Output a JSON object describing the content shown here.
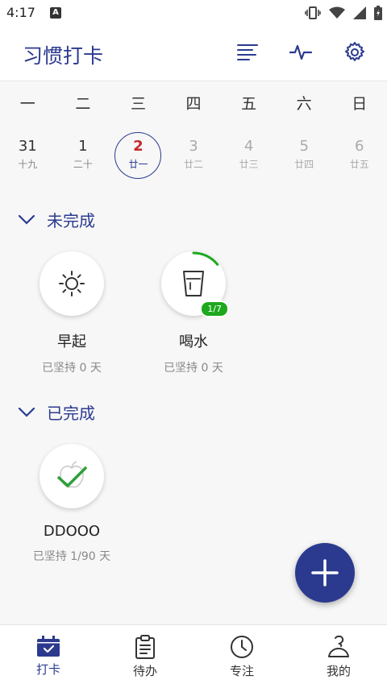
{
  "status_bar": {
    "time": "4:17",
    "notif": "A"
  },
  "app_bar": {
    "title": "习惯打卡"
  },
  "week": {
    "days": [
      "一",
      "二",
      "三",
      "四",
      "五",
      "六",
      "日"
    ],
    "dates": [
      {
        "num": "31",
        "lunar": "十九"
      },
      {
        "num": "1",
        "lunar": "二十"
      },
      {
        "num": "2",
        "lunar": "廿一"
      },
      {
        "num": "3",
        "lunar": "廿二"
      },
      {
        "num": "4",
        "lunar": "廿三"
      },
      {
        "num": "5",
        "lunar": "廿四"
      },
      {
        "num": "6",
        "lunar": "廿五"
      }
    ]
  },
  "sections": {
    "incomplete": {
      "title": "未完成",
      "habits": [
        {
          "name": "早起",
          "streak": "已坚持 0 天"
        },
        {
          "name": "喝水",
          "streak": "已坚持 0 天",
          "badge": "1/7",
          "progress": 0.142857
        }
      ]
    },
    "completed": {
      "title": "已完成",
      "habits": [
        {
          "name": "DDOOO",
          "streak": "已坚持 1/90 天"
        }
      ]
    }
  },
  "bottom_nav": [
    {
      "label": "打卡"
    },
    {
      "label": "待办"
    },
    {
      "label": "专注"
    },
    {
      "label": "我的"
    }
  ],
  "colors": {
    "primary": "#2b3a8f",
    "today_number": "#c62828",
    "success": "#1ea81e",
    "check": "#2e9e3a"
  }
}
